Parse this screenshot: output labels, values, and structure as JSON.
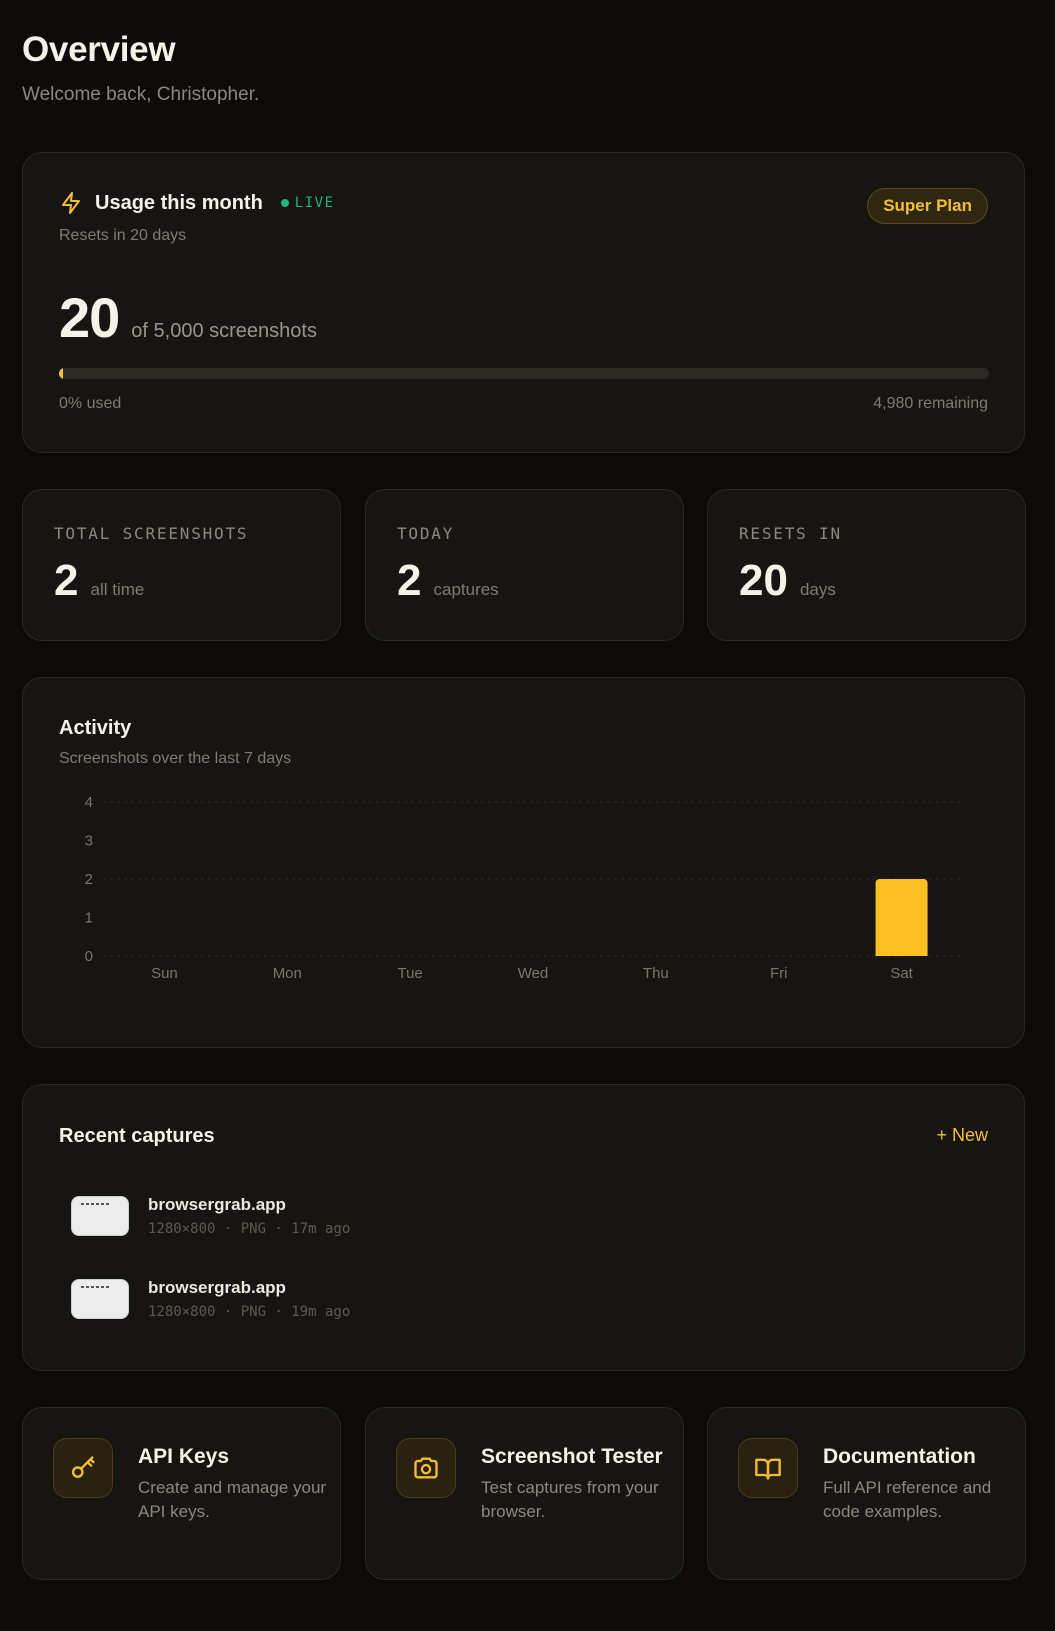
{
  "header": {
    "title": "Overview",
    "subtitle": "Welcome back, Christopher."
  },
  "usage": {
    "title": "Usage this month",
    "live_label": "LIVE",
    "resets_text": "Resets in 20 days",
    "plan_label": "Super Plan",
    "count": "20",
    "of_text": "of 5,000 screenshots",
    "used_fraction": 0.004,
    "used_text": "0% used",
    "remaining_text": "4,980 remaining",
    "accent_color": "#f6be2e",
    "live_color": "#1fb57d"
  },
  "stats": [
    {
      "label": "TOTAL SCREENSHOTS",
      "value": "2",
      "unit": "all time"
    },
    {
      "label": "TODAY",
      "value": "2",
      "unit": "captures"
    },
    {
      "label": "RESETS IN",
      "value": "20",
      "unit": "days"
    }
  ],
  "activity": {
    "title": "Activity",
    "subtitle": "Screenshots over the last 7 days"
  },
  "chart_data": {
    "type": "bar",
    "title": "Activity",
    "subtitle": "Screenshots over the last 7 days",
    "categories": [
      "Sun",
      "Mon",
      "Tue",
      "Wed",
      "Thu",
      "Fri",
      "Sat"
    ],
    "values": [
      0,
      0,
      0,
      0,
      0,
      0,
      2
    ],
    "yticks": [
      "0",
      "1",
      "2",
      "3",
      "4"
    ],
    "ylim": [
      0,
      4
    ],
    "grid": true,
    "bar_color": "#fbbf24"
  },
  "recent": {
    "title": "Recent captures",
    "new_label": "+ New",
    "items": [
      {
        "domain": "browsergrab.app",
        "meta": "1280×800 · PNG · 17m ago"
      },
      {
        "domain": "browsergrab.app",
        "meta": "1280×800 · PNG · 19m ago"
      }
    ]
  },
  "links": [
    {
      "title": "API Keys",
      "desc": "Create and manage your API keys.",
      "icon": "key-icon"
    },
    {
      "title": "Screenshot Tester",
      "desc": "Test captures from your browser.",
      "icon": "camera-icon"
    },
    {
      "title": "Documentation",
      "desc": "Full API reference and code examples.",
      "icon": "book-icon"
    }
  ]
}
